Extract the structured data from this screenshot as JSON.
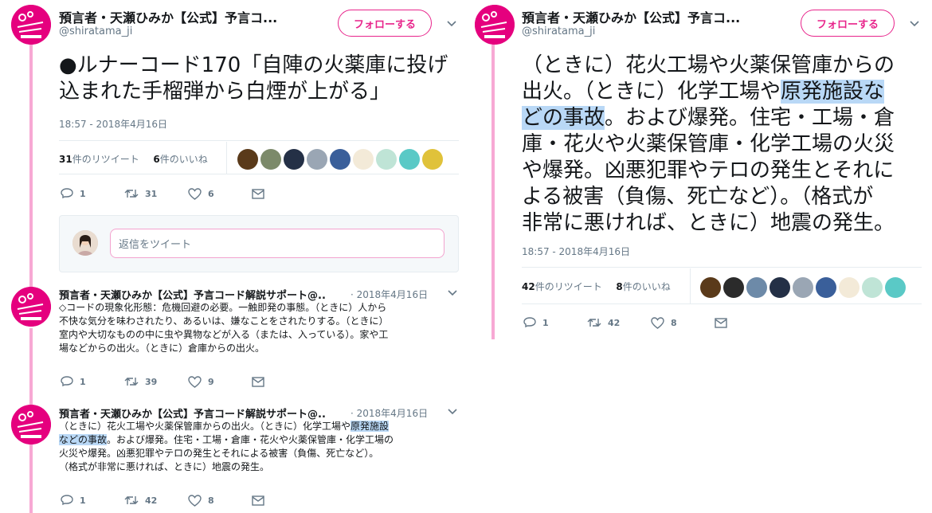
{
  "account": {
    "name": "預言者・天瀬ひみか【公式】予言コ...",
    "handle": "@shiratama_ji",
    "follow_label": "フォローする",
    "brand_color": "#e5007e"
  },
  "left": {
    "tweet_lines": [
      "●ルナーコード170「自陣の火薬庫に投げ",
      "込まれた手榴弾から白煙が上がる」"
    ],
    "timestamp": "18:57 - 2018年4月16日",
    "retweet_count": "31",
    "retweet_label": "件のリツイート",
    "like_count": "6",
    "like_label": "件のいいね",
    "actions": {
      "reply": "1",
      "retweet": "31",
      "like": "6"
    },
    "reply_placeholder": "返信をツイート"
  },
  "replies": [
    {
      "name": "預言者・天瀬ひみか【公式】予言コード解説サポート@..",
      "date": "· 2018年4月16日",
      "lines": [
        "◇コードの現象化形態：危機回避の必要。一触即発の事態。（ときに）人から",
        "不快な気分を味わされたり、あるいは、嫌なことをされたりする。（ときに）",
        "室内や大切なものの中に虫や異物などが入る（または、入っている）。家や工",
        "場などからの出火。（ときに）倉庫からの出火。"
      ],
      "actions": {
        "reply": "1",
        "retweet": "39",
        "like": "9"
      }
    },
    {
      "name": "預言者・天瀬ひみか【公式】予言コード解説サポート@..",
      "date": "· 2018年4月16日",
      "line1_pre": "（ときに）花火工場や火薬保管庫からの出火。（ときに）化学工場や",
      "line1_hl": "原発施設",
      "line2_hl": "などの事故",
      "line2_post": "。および爆発。住宅・工場・倉庫・花火や火薬保管庫・化学工場の",
      "lines_rest": [
        "火災や爆発。凶悪犯罪やテロの発生とそれによる被害（負傷、死亡など）。",
        "（格式が非常に悪ければ、ときに）地震の発生。"
      ],
      "actions": {
        "reply": "1",
        "retweet": "42",
        "like": "8"
      }
    }
  ],
  "right": {
    "line1": "（ときに）花火工場や火薬保管庫からの",
    "line2_pre": "出火。（ときに）化学工場や",
    "line2_hl": "原発施設な",
    "line3_hl": "どの事故",
    "line3_post": "。および爆発。住宅・工場・倉",
    "lines_rest": [
      "庫・花火や火薬保管庫・化学工場の火災",
      "や爆発。凶悪犯罪やテロの発生とそれに",
      "よる被害（負傷、死亡など）。（格式が",
      "非常に悪ければ、ときに）地震の発生。"
    ],
    "timestamp": "18:57 - 2018年4月16日",
    "retweet_count": "42",
    "retweet_label": "件のリツイート",
    "like_count": "8",
    "like_label": "件のいいね",
    "actions": {
      "reply": "1",
      "retweet": "42",
      "like": "8"
    }
  }
}
